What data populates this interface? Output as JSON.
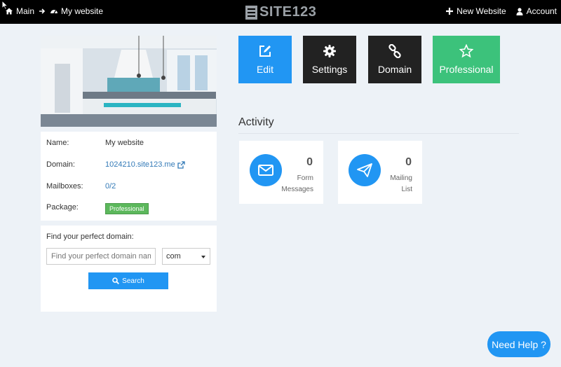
{
  "topbar": {
    "breadcrumb_main": "Main",
    "breadcrumb_site": "My website",
    "logo_text": "SITE123",
    "new_website": "New Website",
    "account": "Account"
  },
  "site_info": {
    "name_label": "Name:",
    "name_value": "My website",
    "domain_label": "Domain:",
    "domain_value": "1024210.site123.me",
    "mailboxes_label": "Mailboxes:",
    "mailboxes_value": "0/2",
    "package_label": "Package:",
    "package_value": "Professional"
  },
  "find_domain": {
    "title": "Find your perfect domain:",
    "placeholder": "Find your perfect domain name",
    "tld": "com",
    "search_label": "Search"
  },
  "tiles": {
    "edit": "Edit",
    "settings": "Settings",
    "domain": "Domain",
    "professional": "Professional"
  },
  "activity": {
    "title": "Activity",
    "form_count": "0",
    "form_label_1": "Form",
    "form_label_2": "Messages",
    "mailing_count": "0",
    "mailing_label_1": "Mailing",
    "mailing_label_2": "List"
  },
  "help_label": "Need Help ?",
  "colors": {
    "accent": "#2196f3",
    "dark_tile": "#222222",
    "professional": "#3cc27b",
    "badge": "#5cb85c"
  }
}
